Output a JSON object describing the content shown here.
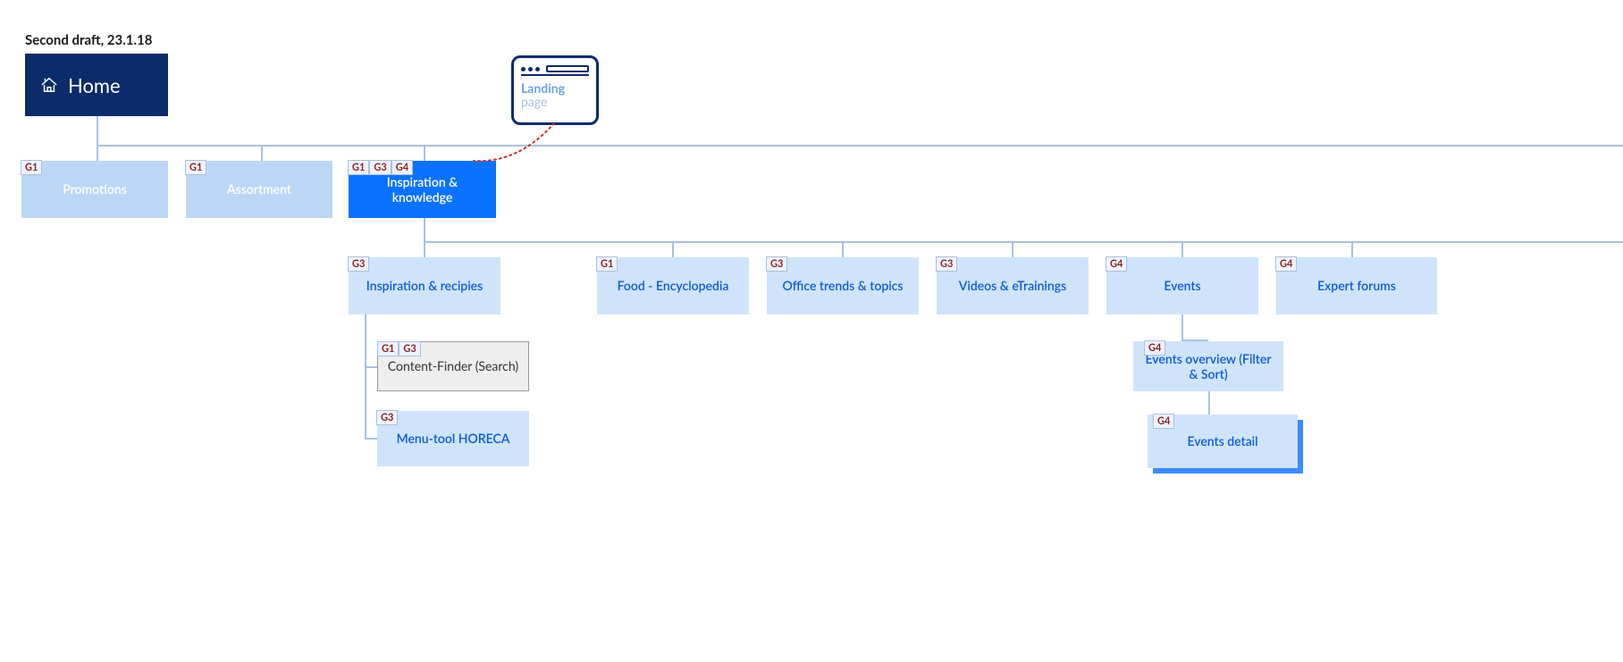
{
  "title": "Second draft, 23.1.18",
  "home": {
    "label": "Home"
  },
  "landing": {
    "line1": "Landing",
    "line2": "page"
  },
  "level1": {
    "promotions": {
      "label": "Promotions",
      "tags": [
        "G1"
      ]
    },
    "assortment": {
      "label": "Assortment",
      "tags": [
        "G1"
      ]
    },
    "inspiration": {
      "label": "Inspiration & knowledge",
      "tags": [
        "G1",
        "G3",
        "G4"
      ]
    }
  },
  "level2": {
    "inspiration_recipies": {
      "label": "Inspiration & recipies",
      "tags": [
        "G3"
      ]
    },
    "food_encyclopedia": {
      "label": "Food - Encyclopedia",
      "tags": [
        "G1"
      ]
    },
    "office_trends": {
      "label": "Office trends & topics",
      "tags": [
        "G3"
      ]
    },
    "videos_etrainings": {
      "label": "Videos & eTrainings",
      "tags": [
        "G3"
      ]
    },
    "events": {
      "label": "Events",
      "tags": [
        "G4"
      ]
    },
    "expert_forums": {
      "label": "Expert forums",
      "tags": [
        "G4"
      ]
    }
  },
  "level3": {
    "content_finder": {
      "label": "Content-Finder (Search)",
      "tags": [
        "G1",
        "G3"
      ]
    },
    "menu_tool": {
      "label": "Menu-tool HORECA",
      "tags": [
        "G3"
      ]
    },
    "events_overview": {
      "label": "Events overview (Filter & Sort)",
      "tags": [
        "G4"
      ]
    },
    "events_detail": {
      "label": "Events detail",
      "tags": [
        "G4"
      ]
    }
  }
}
